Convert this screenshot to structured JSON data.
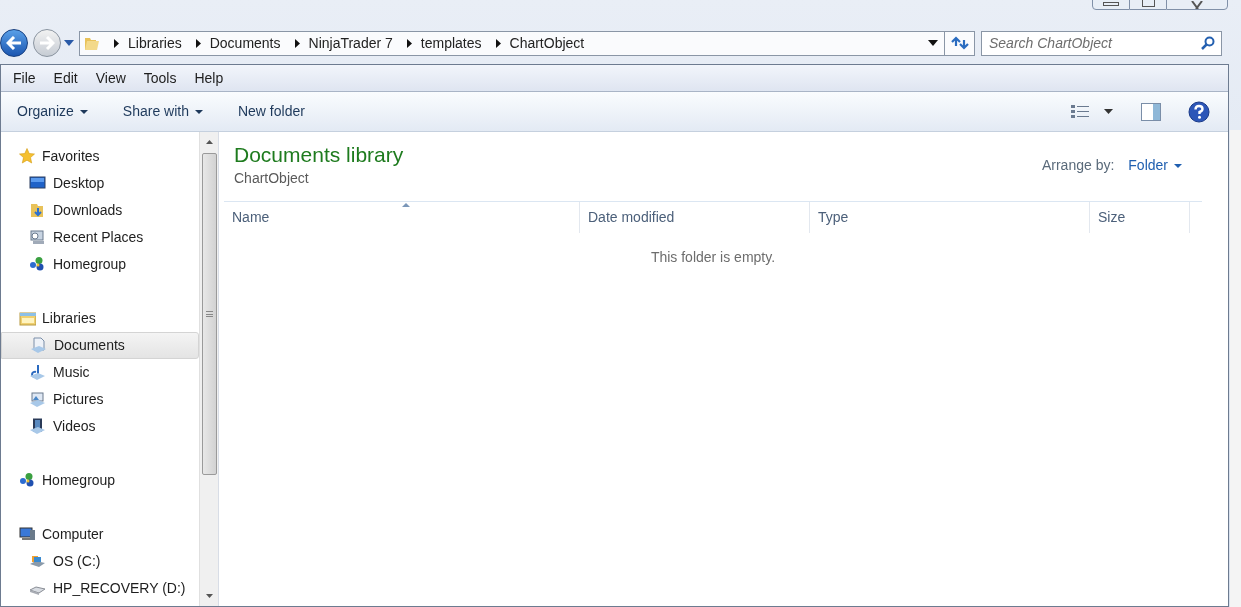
{
  "breadcrumbs": [
    "Libraries",
    "Documents",
    "NinjaTrader 7",
    "templates",
    "ChartObject"
  ],
  "search": {
    "placeholder": "Search ChartObject"
  },
  "menu": [
    "File",
    "Edit",
    "View",
    "Tools",
    "Help"
  ],
  "toolbar": [
    {
      "label": "Organize",
      "dropdown": true
    },
    {
      "label": "Share with",
      "dropdown": true
    },
    {
      "label": "New folder",
      "dropdown": false
    }
  ],
  "sidebar": {
    "groups": [
      {
        "label": "Favorites",
        "kind": "star",
        "children": [
          {
            "label": "Desktop",
            "kind": "desktop",
            "selected": false
          },
          {
            "label": "Downloads",
            "kind": "downloads",
            "selected": false
          },
          {
            "label": "Recent Places",
            "kind": "recent",
            "selected": false
          },
          {
            "label": "Homegroup",
            "kind": "homegroup",
            "selected": false
          }
        ]
      },
      {
        "label": "Libraries",
        "kind": "library",
        "children": [
          {
            "label": "Documents",
            "kind": "documents",
            "selected": true
          },
          {
            "label": "Music",
            "kind": "music",
            "selected": false
          },
          {
            "label": "Pictures",
            "kind": "pictures",
            "selected": false
          },
          {
            "label": "Videos",
            "kind": "videos",
            "selected": false
          }
        ]
      },
      {
        "label": "Homegroup",
        "kind": "homegroup"
      },
      {
        "label": "Computer",
        "kind": "computer",
        "children": [
          {
            "label": "OS (C:)",
            "kind": "drive",
            "selected": false
          },
          {
            "label": "HP_RECOVERY (D:)",
            "kind": "disk",
            "selected": false
          }
        ]
      }
    ]
  },
  "library": {
    "title": "Documents library",
    "subtitle": "ChartObject",
    "arrange_label": "Arrange by:",
    "arrange_value": "Folder"
  },
  "table": {
    "columns": [
      {
        "label": "Name",
        "sorted": true
      },
      {
        "label": "Date modified",
        "sorted": false
      },
      {
        "label": "Type",
        "sorted": false
      },
      {
        "label": "Size",
        "sorted": false
      }
    ],
    "empty_message": "This folder is empty."
  }
}
